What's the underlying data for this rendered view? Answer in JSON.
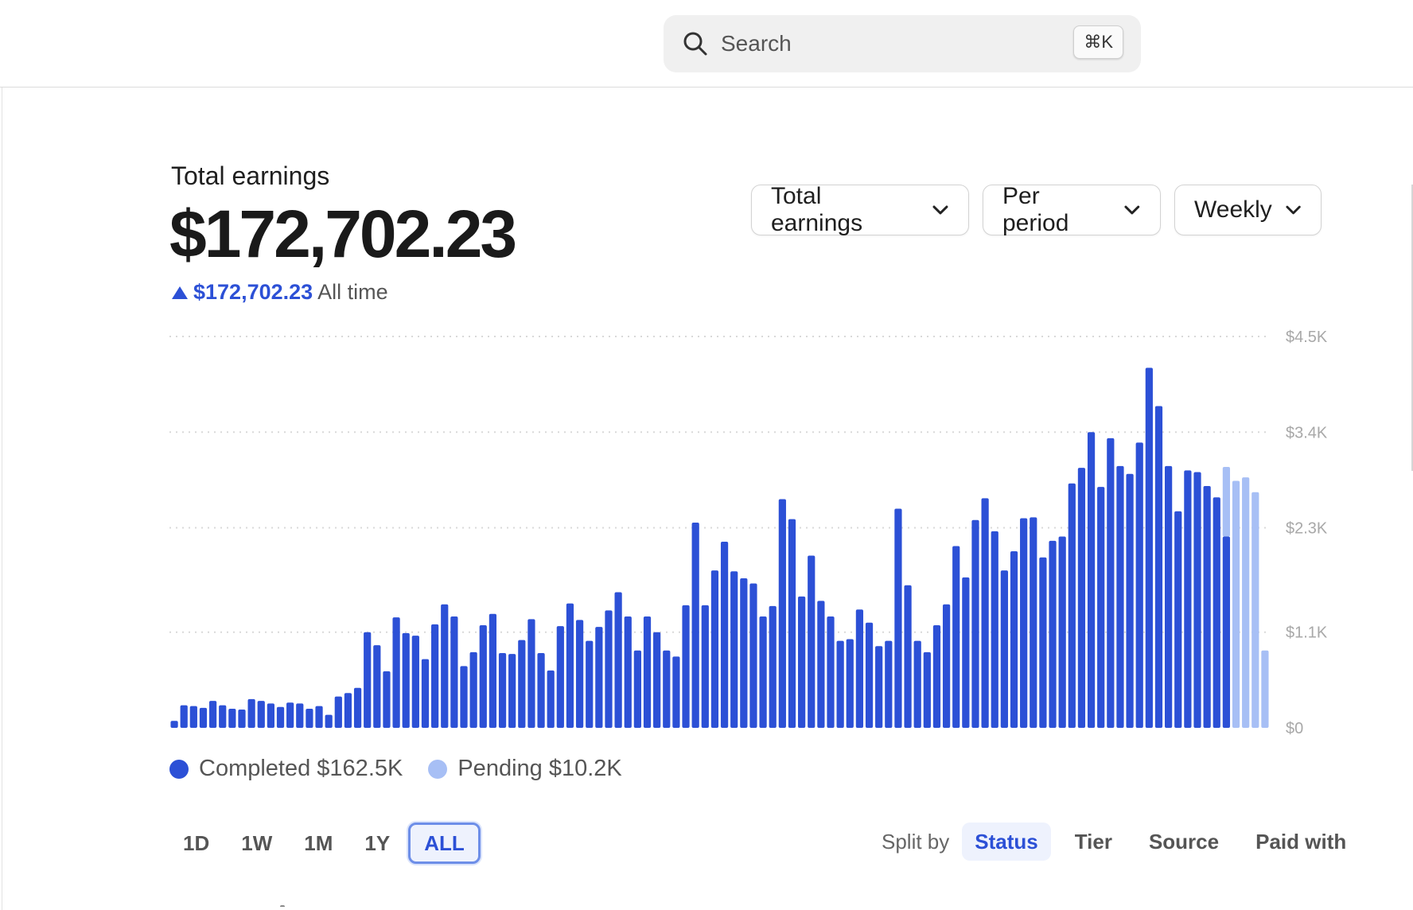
{
  "search": {
    "placeholder": "Search",
    "shortcut": "⌘K",
    "icon": "search-icon"
  },
  "earnings": {
    "title": "Total earnings",
    "amount": "$172,702.23",
    "change_value": "$172,702.23",
    "change_label": "All time",
    "change_icon": "triangle-up-icon"
  },
  "dropdowns": {
    "metric": "Total earnings",
    "mode": "Per period",
    "interval": "Weekly"
  },
  "colors": {
    "completed": "#2c50d6",
    "pending": "#a7bff5",
    "accent": "#2c50d6"
  },
  "legend": {
    "completed": "Completed $162.5K",
    "pending": "Pending $10.2K"
  },
  "ranges": [
    "1D",
    "1W",
    "1M",
    "1Y",
    "ALL"
  ],
  "active_range": "ALL",
  "split": {
    "label": "Split by",
    "options": [
      "Status",
      "Tier",
      "Source",
      "Paid with"
    ],
    "active": "Status"
  },
  "chart_data": {
    "type": "bar",
    "stacked": true,
    "y_tick_labels": [
      "$4.5K",
      "$3.4K",
      "$2.3K",
      "$1.1K",
      "$0"
    ],
    "y_ticks": [
      4500,
      3400,
      2300,
      1100,
      0
    ],
    "ylim": [
      0,
      4500
    ],
    "grid": true,
    "y_axis_side": "right",
    "legend_position": "bottom-left",
    "series": [
      {
        "name": "Completed",
        "values": [
          80,
          260,
          250,
          230,
          310,
          260,
          220,
          210,
          330,
          310,
          280,
          240,
          290,
          280,
          220,
          250,
          150,
          360,
          400,
          460,
          1100,
          950,
          650,
          1270,
          1090,
          1060,
          790,
          1190,
          1420,
          1280,
          710,
          870,
          1180,
          1310,
          860,
          850,
          1010,
          1250,
          860,
          660,
          1170,
          1430,
          1240,
          1000,
          1160,
          1350,
          1560,
          1280,
          890,
          1280,
          1100,
          890,
          820,
          1410,
          2360,
          1410,
          1810,
          2140,
          1800,
          1720,
          1660,
          1280,
          1400,
          2630,
          2400,
          1510,
          1980,
          1460,
          1280,
          1000,
          1020,
          1360,
          1210,
          940,
          1000,
          2520,
          1640,
          1000,
          870,
          1180,
          1420,
          2090,
          1730,
          2390,
          2640,
          2260,
          1810,
          2030,
          2410,
          2420,
          1960,
          2150,
          2200,
          2810,
          2990,
          3400,
          2770,
          3330,
          3010,
          2920,
          3280,
          4140,
          3700,
          3010,
          2490,
          2960,
          2940,
          2780,
          2650,
          2200,
          0,
          0,
          0,
          0
        ],
        "pending": [
          0,
          0,
          0,
          0,
          0,
          0,
          0,
          0,
          0,
          0,
          0,
          0,
          0,
          0,
          0,
          0,
          0,
          0,
          0,
          0,
          0,
          0,
          0,
          0,
          0,
          0,
          0,
          0,
          0,
          0,
          0,
          0,
          0,
          0,
          0,
          0,
          0,
          0,
          0,
          0,
          0,
          0,
          0,
          0,
          0,
          0,
          0,
          0,
          0,
          0,
          0,
          0,
          0,
          0,
          0,
          0,
          0,
          0,
          0,
          0,
          0,
          0,
          0,
          0,
          0,
          0,
          0,
          0,
          0,
          0,
          0,
          0,
          0,
          0,
          0,
          0,
          0,
          0,
          0,
          0,
          0,
          0,
          0,
          0,
          0,
          0,
          0,
          0,
          0,
          0,
          0,
          0,
          0,
          0,
          0,
          0,
          0,
          0,
          0,
          0,
          0,
          0,
          0,
          0,
          0,
          0,
          0,
          0,
          0,
          800,
          2840,
          2880,
          2710,
          890
        ]
      },
      {
        "name": "Pending",
        "values": [
          0,
          0,
          0,
          0,
          0,
          0,
          0,
          0,
          0,
          0,
          0,
          0,
          0,
          0,
          0,
          0,
          0,
          0,
          0,
          0,
          0,
          0,
          0,
          0,
          0,
          0,
          0,
          0,
          0,
          0,
          0,
          0,
          0,
          0,
          0,
          0,
          0,
          0,
          0,
          0,
          0,
          0,
          0,
          0,
          0,
          0,
          0,
          0,
          0,
          0,
          0,
          0,
          0,
          0,
          0,
          0,
          0,
          0,
          0,
          0,
          0,
          0,
          0,
          0,
          0,
          0,
          0,
          0,
          0,
          0,
          0,
          0,
          0,
          0,
          0,
          0,
          0,
          0,
          0,
          0,
          0,
          0,
          0,
          0,
          0,
          0,
          0,
          0,
          0,
          0,
          0,
          0,
          0,
          0,
          0,
          0,
          0,
          0,
          0,
          0,
          0,
          0,
          0,
          0,
          0,
          0,
          0,
          0,
          0,
          800,
          2840,
          2880,
          2710,
          890
        ]
      }
    ]
  }
}
